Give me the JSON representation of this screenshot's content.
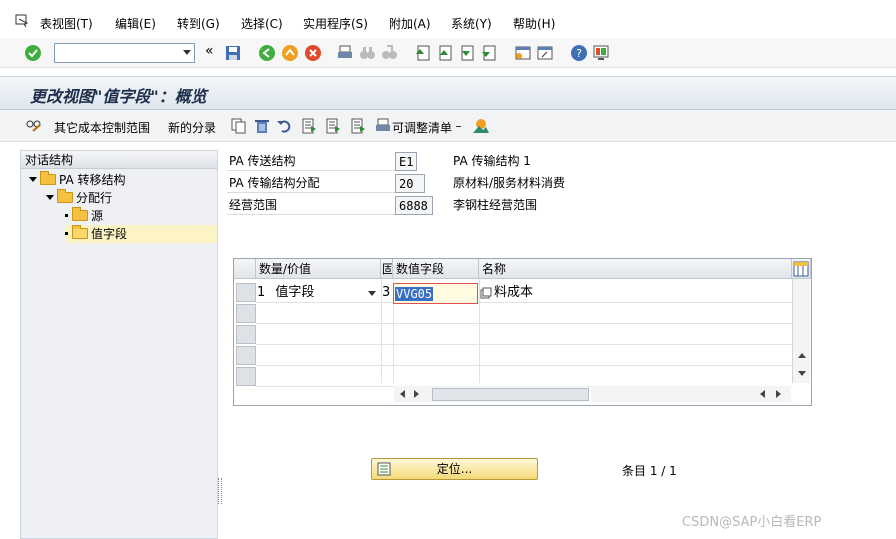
{
  "menu": [
    "表视图(T)",
    "编辑(E)",
    "转到(G)",
    "选择(C)",
    "实用程序(S)",
    "附加(A)",
    "系统(Y)",
    "帮助(H)"
  ],
  "toolbar": {
    "collapse_glyph": "«"
  },
  "title": "更改视图\"值字段\"：概览",
  "app_toolbar": {
    "other_cost_control_area": "其它成本控制范围",
    "new_entries": "新的分录",
    "adjustable_list": "可调整清单"
  },
  "tree": {
    "header": "对话结构",
    "nodes": [
      {
        "label": "PA 转移结构",
        "type": "folder",
        "level": 0,
        "expanded": true
      },
      {
        "label": "分配行",
        "type": "folder",
        "level": 1,
        "expanded": true
      },
      {
        "label": "源",
        "type": "folder",
        "level": 2
      },
      {
        "label": "值字段",
        "type": "folder-open",
        "level": 2,
        "selected": true
      }
    ]
  },
  "fields": [
    {
      "label": "PA 传送结构",
      "value": "E1",
      "desc": "PA 传输结构 1"
    },
    {
      "label": "PA 传输结构分配",
      "value": "20",
      "desc": "原材料/服务材料消费"
    },
    {
      "label": "经营范围",
      "value": "6888",
      "desc": "李钢柱经营范围"
    }
  ],
  "table": {
    "columns": [
      "数量/价值",
      "固",
      "数值字段",
      "名称"
    ],
    "rows": [
      {
        "qty_value_num": "1",
        "qty_value_text": "值字段",
        "fixed": "3",
        "value_field": "VVG05",
        "name": "料成本"
      }
    ],
    "empty_rows": 4
  },
  "locate_button": "定位...",
  "entry_count": "条目 1 / 1",
  "watermark": "CSDN@SAP小白看ERP"
}
